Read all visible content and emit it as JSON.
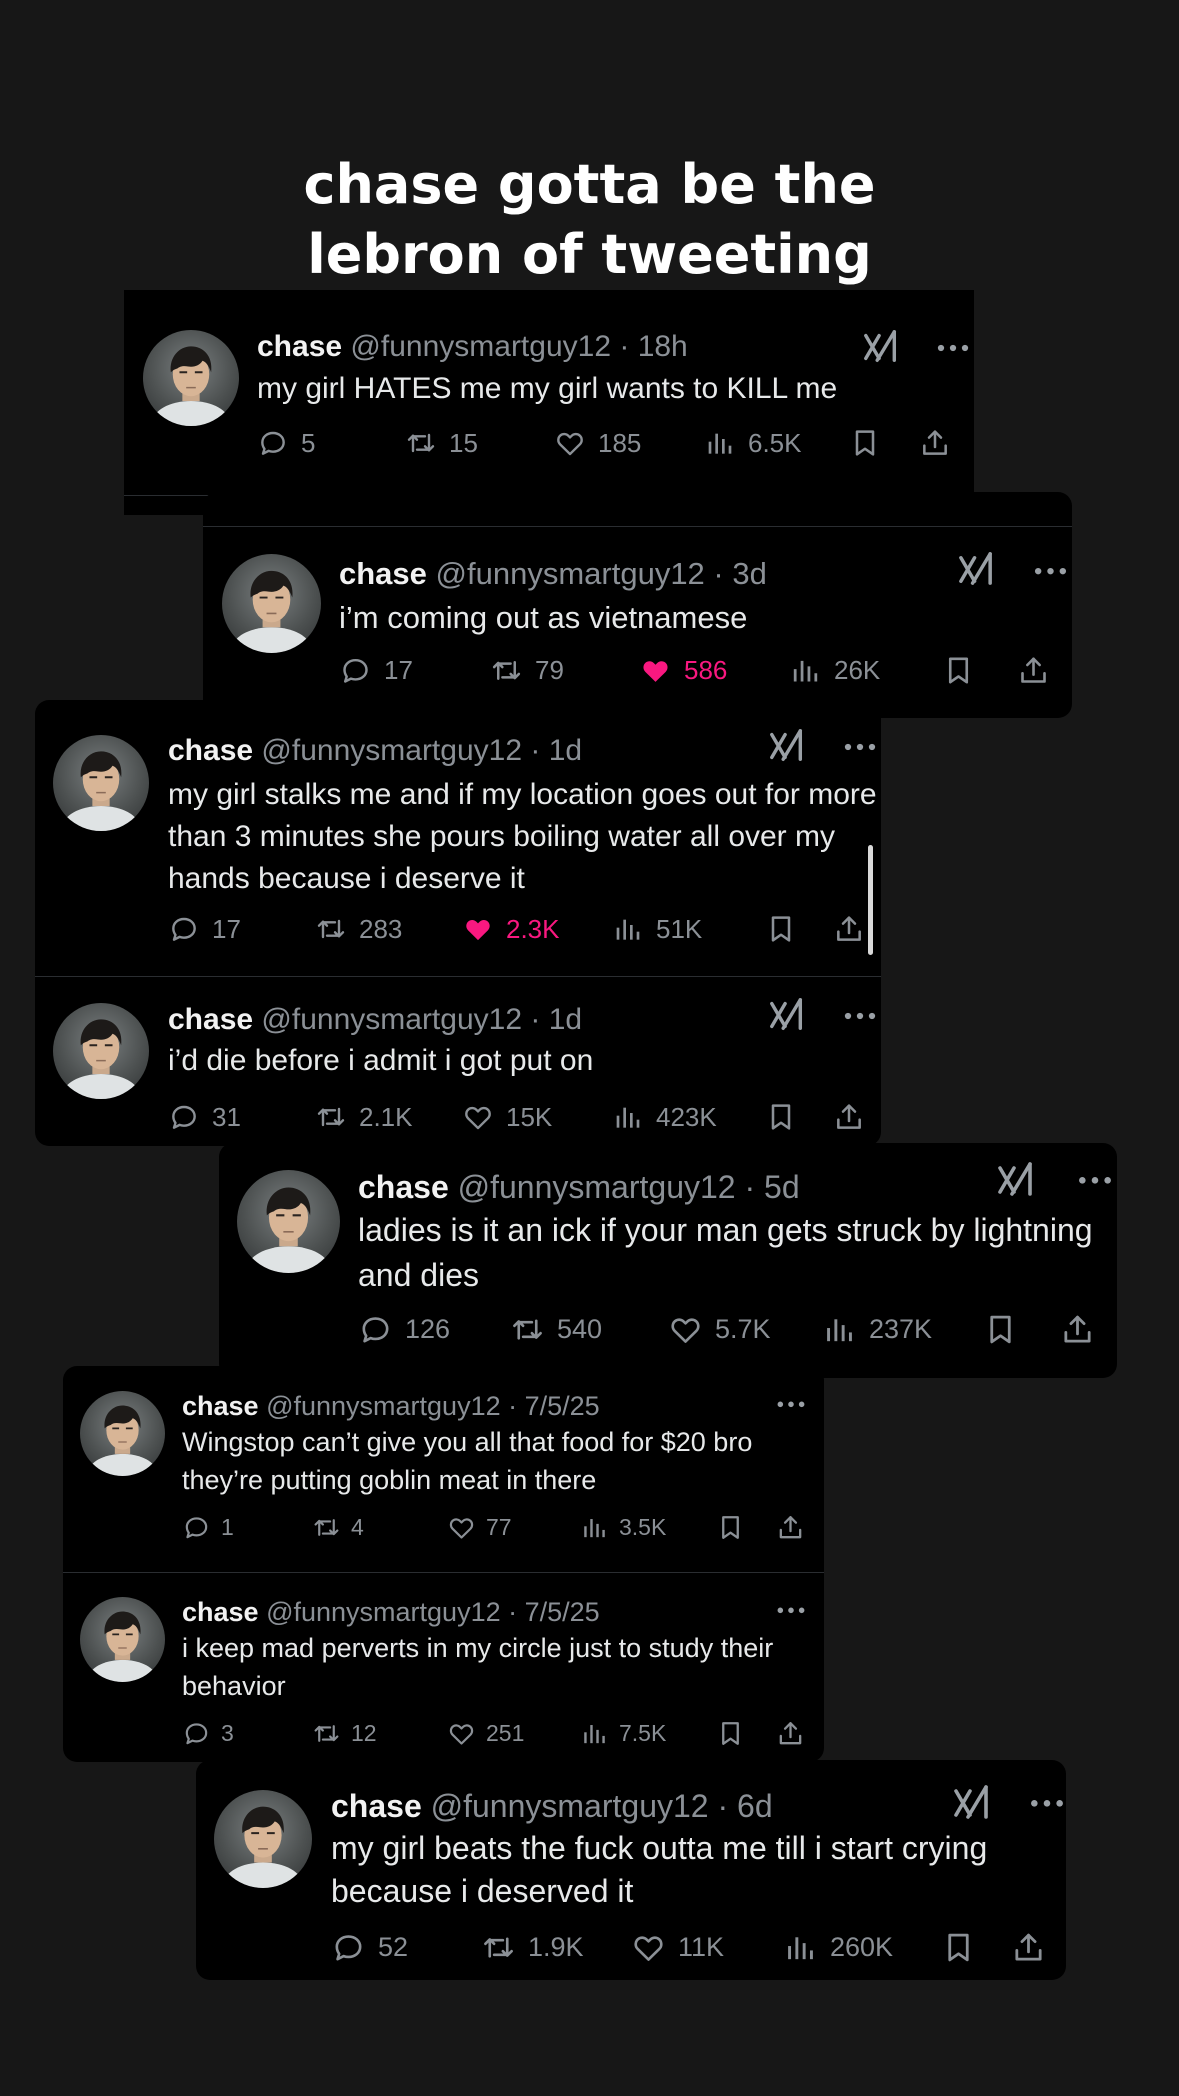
{
  "headline": {
    "line1": "chase gotta be the",
    "line2": "lebron of tweeting"
  },
  "colors": {
    "background": "#171717",
    "card": "#000000",
    "like_active": "#f91880",
    "muted": "#8b9096"
  },
  "icons": {
    "brand": "grok-icon",
    "menu": "more-icon",
    "reply": "reply-icon",
    "repost": "repost-icon",
    "like": "heart-icon",
    "views": "views-icon",
    "bookmark": "bookmark-icon",
    "share": "share-icon"
  },
  "tweets": [
    {
      "name": "chase",
      "handle": "@funnysmartguy12",
      "time": "18h",
      "text": "my girl HATES me my girl wants to KILL me",
      "replies": "5",
      "reposts": "15",
      "likes": "185",
      "liked": false,
      "views": "6.5K"
    },
    {
      "name": "chase",
      "handle": "@funnysmartguy12",
      "time": "3d",
      "text": "i’m coming out as vietnamese",
      "replies": "17",
      "reposts": "79",
      "likes": "586",
      "liked": true,
      "views": "26K"
    },
    {
      "name": "chase",
      "handle": "@funnysmartguy12",
      "time": "1d",
      "text": "my girl stalks me and if my location goes out for more than 3 minutes she pours boiling water all over my hands because i deserve it",
      "replies": "17",
      "reposts": "283",
      "likes": "2.3K",
      "liked": true,
      "views": "51K"
    },
    {
      "name": "chase",
      "handle": "@funnysmartguy12",
      "time": "1d",
      "text": "i’d die before i admit i got put on",
      "replies": "31",
      "reposts": "2.1K",
      "likes": "15K",
      "liked": false,
      "views": "423K"
    },
    {
      "name": "chase",
      "handle": "@funnysmartguy12",
      "time": "5d",
      "text": "ladies is it an ick if your man gets struck by lightning and dies",
      "replies": "126",
      "reposts": "540",
      "likes": "5.7K",
      "liked": false,
      "views": "237K"
    },
    {
      "name": "chase",
      "handle": "@funnysmartguy12",
      "time": "7/5/25",
      "text": "Wingstop can’t give you all that food for $20 bro they’re putting goblin meat in there",
      "replies": "1",
      "reposts": "4",
      "likes": "77",
      "liked": false,
      "views": "3.5K"
    },
    {
      "name": "chase",
      "handle": "@funnysmartguy12",
      "time": "7/5/25",
      "text": "i keep mad perverts in my circle just to study their behavior",
      "replies": "3",
      "reposts": "12",
      "likes": "251",
      "liked": false,
      "views": "7.5K"
    },
    {
      "name": "chase",
      "handle": "@funnysmartguy12",
      "time": "6d",
      "text": "my girl beats the fuck outta me till i start crying because i deserved it",
      "replies": "52",
      "reposts": "1.9K",
      "likes": "11K",
      "liked": false,
      "views": "260K"
    }
  ]
}
